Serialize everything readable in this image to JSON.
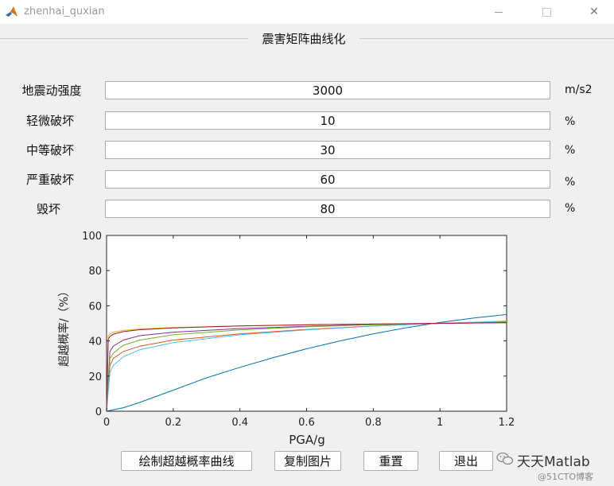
{
  "window": {
    "title": "zhenhai_quxian",
    "minimize_glyph": "—",
    "close_glyph": "✕"
  },
  "panel": {
    "title": "震害矩阵曲线化"
  },
  "form": {
    "rows": [
      {
        "label": "地震动强度",
        "value": "3000",
        "unit": "m/s2"
      },
      {
        "label": "轻微破坏",
        "value": "10",
        "unit": "%"
      },
      {
        "label": "中等破坏",
        "value": "30",
        "unit": "%"
      },
      {
        "label": "严重破坏",
        "value": "60",
        "unit": "%"
      },
      {
        "label": "毁坏",
        "value": "80",
        "unit": "%"
      }
    ]
  },
  "chart_data": {
    "type": "line",
    "xlabel": "PGA/g",
    "ylabel": "超越概率/（%）",
    "xlim": [
      0,
      1.2
    ],
    "ylim": [
      0,
      100
    ],
    "xticks": [
      "0",
      "0.2",
      "0.4",
      "0.6",
      "0.8",
      "1",
      "1.2"
    ],
    "yticks": [
      "0",
      "20",
      "40",
      "60",
      "80",
      "100"
    ],
    "grid": false,
    "series": [
      {
        "color": "#0072bd",
        "x": [
          0,
          0.05,
          0.1,
          0.2,
          0.3,
          0.4,
          0.5,
          0.6,
          0.7,
          0.8,
          0.9,
          1.0,
          1.1,
          1.2
        ],
        "y": [
          0,
          2,
          5,
          12,
          19,
          25,
          30.5,
          35.5,
          40,
          44,
          47.5,
          50.5,
          53,
          55
        ]
      },
      {
        "color": "#d95319",
        "x": [
          0,
          0.01,
          0.02,
          0.05,
          0.1,
          0.2,
          0.4,
          0.6,
          0.8,
          1.0,
          1.2
        ],
        "y": [
          0,
          26,
          30,
          34,
          37,
          40.5,
          44,
          46.5,
          48.5,
          50,
          51
        ]
      },
      {
        "color": "#edb120",
        "x": [
          0,
          0.005,
          0.01,
          0.02,
          0.05,
          0.1,
          0.2,
          0.4,
          0.6,
          0.8,
          1.0,
          1.2
        ],
        "y": [
          0,
          43,
          44,
          45,
          46,
          46.8,
          47.6,
          48.5,
          49.1,
          49.6,
          50,
          50.4
        ]
      },
      {
        "color": "#7e2f8e",
        "x": [
          0,
          0.01,
          0.02,
          0.05,
          0.1,
          0.2,
          0.4,
          0.6,
          0.8,
          1.0,
          1.2
        ],
        "y": [
          0,
          34,
          37,
          40.5,
          43,
          45,
          47,
          48.3,
          49.3,
          50,
          50.6
        ]
      },
      {
        "color": "#77ac30",
        "x": [
          0,
          0.01,
          0.02,
          0.05,
          0.1,
          0.2,
          0.4,
          0.6,
          0.8,
          1.0,
          1.2
        ],
        "y": [
          0,
          30,
          33,
          37.5,
          40.5,
          43.5,
          46.3,
          48,
          49.2,
          50,
          50.8
        ]
      },
      {
        "color": "#4dbeee",
        "x": [
          0,
          0.01,
          0.02,
          0.05,
          0.1,
          0.2,
          0.4,
          0.6,
          0.8,
          1.0,
          1.2
        ],
        "y": [
          0,
          22,
          26,
          31,
          35,
          39,
          43.5,
          46.3,
          48.4,
          50,
          51.3
        ]
      },
      {
        "color": "#a2142f",
        "x": [
          0,
          0.005,
          0.01,
          0.02,
          0.05,
          0.1,
          0.2,
          0.4,
          0.6,
          0.8,
          1.0,
          1.2
        ],
        "y": [
          0,
          41,
          42.5,
          43.8,
          45.3,
          46.4,
          47.4,
          48.5,
          49.2,
          49.6,
          50,
          50.3
        ]
      }
    ]
  },
  "buttons": {
    "draw": "绘制超越概率曲线",
    "copy": "复制图片",
    "reset": "重置",
    "exit": "退出"
  },
  "watermark": {
    "main": "天天Matlab",
    "sub": "@51CTO博客"
  }
}
